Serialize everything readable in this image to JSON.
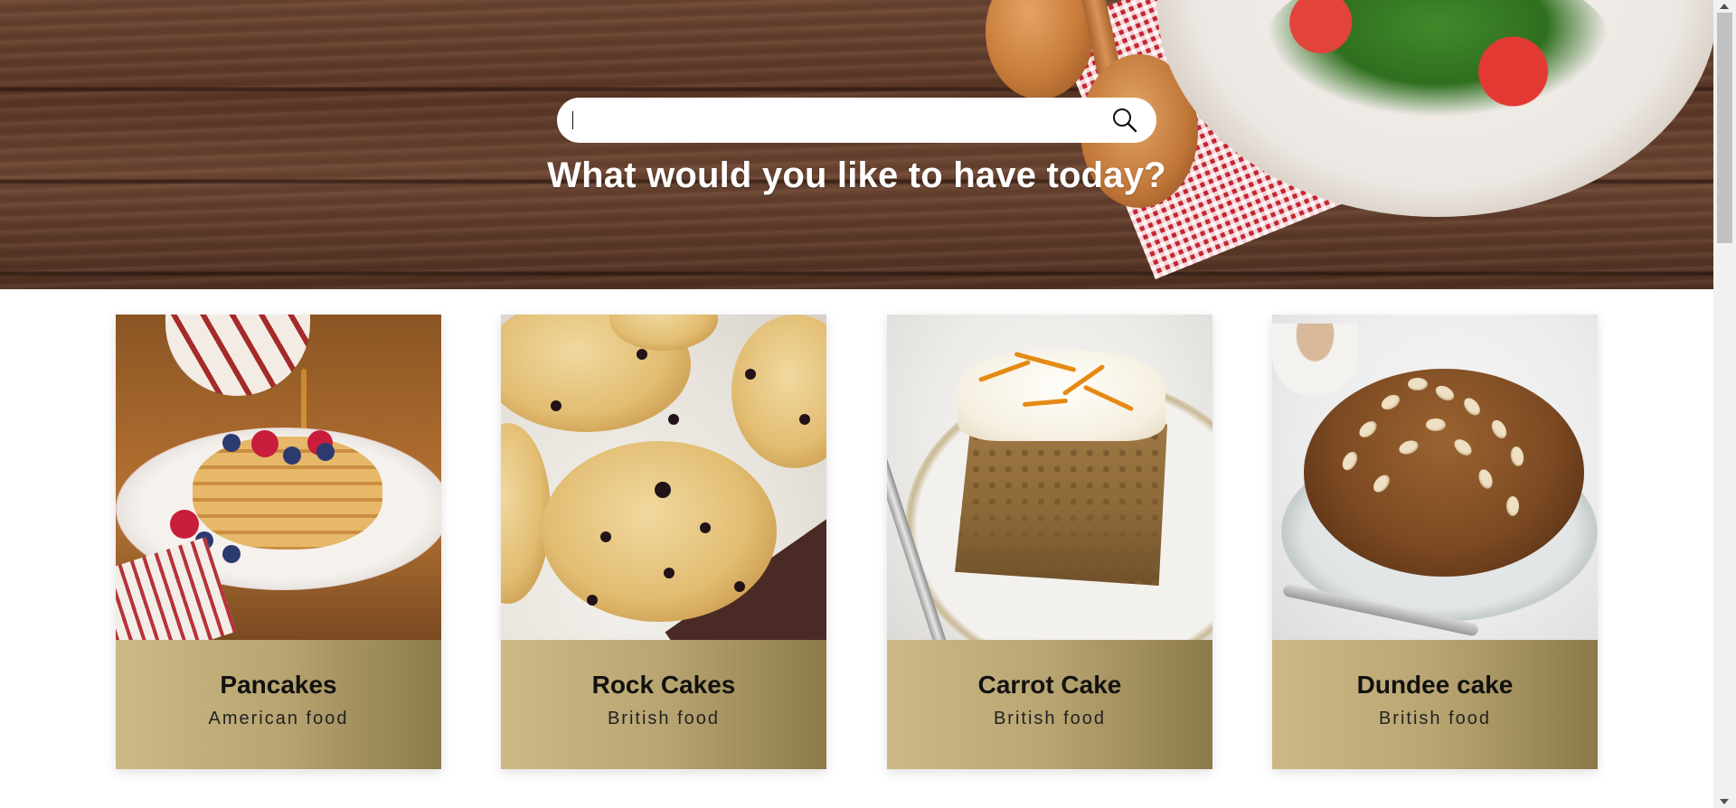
{
  "hero": {
    "heading": "What would you like to have today?",
    "search": {
      "value": "",
      "placeholder": "",
      "icon": "search-icon"
    }
  },
  "recipes": [
    {
      "name": "Pancakes",
      "cuisine": "American food"
    },
    {
      "name": "Rock Cakes",
      "cuisine": "British food"
    },
    {
      "name": "Carrot Cake",
      "cuisine": "British food"
    },
    {
      "name": "Dundee cake",
      "cuisine": "British food"
    }
  ],
  "colors": {
    "card_gradient_start": "#cdb985",
    "card_gradient_end": "#8c7a4a",
    "heading": "#ffffff"
  }
}
